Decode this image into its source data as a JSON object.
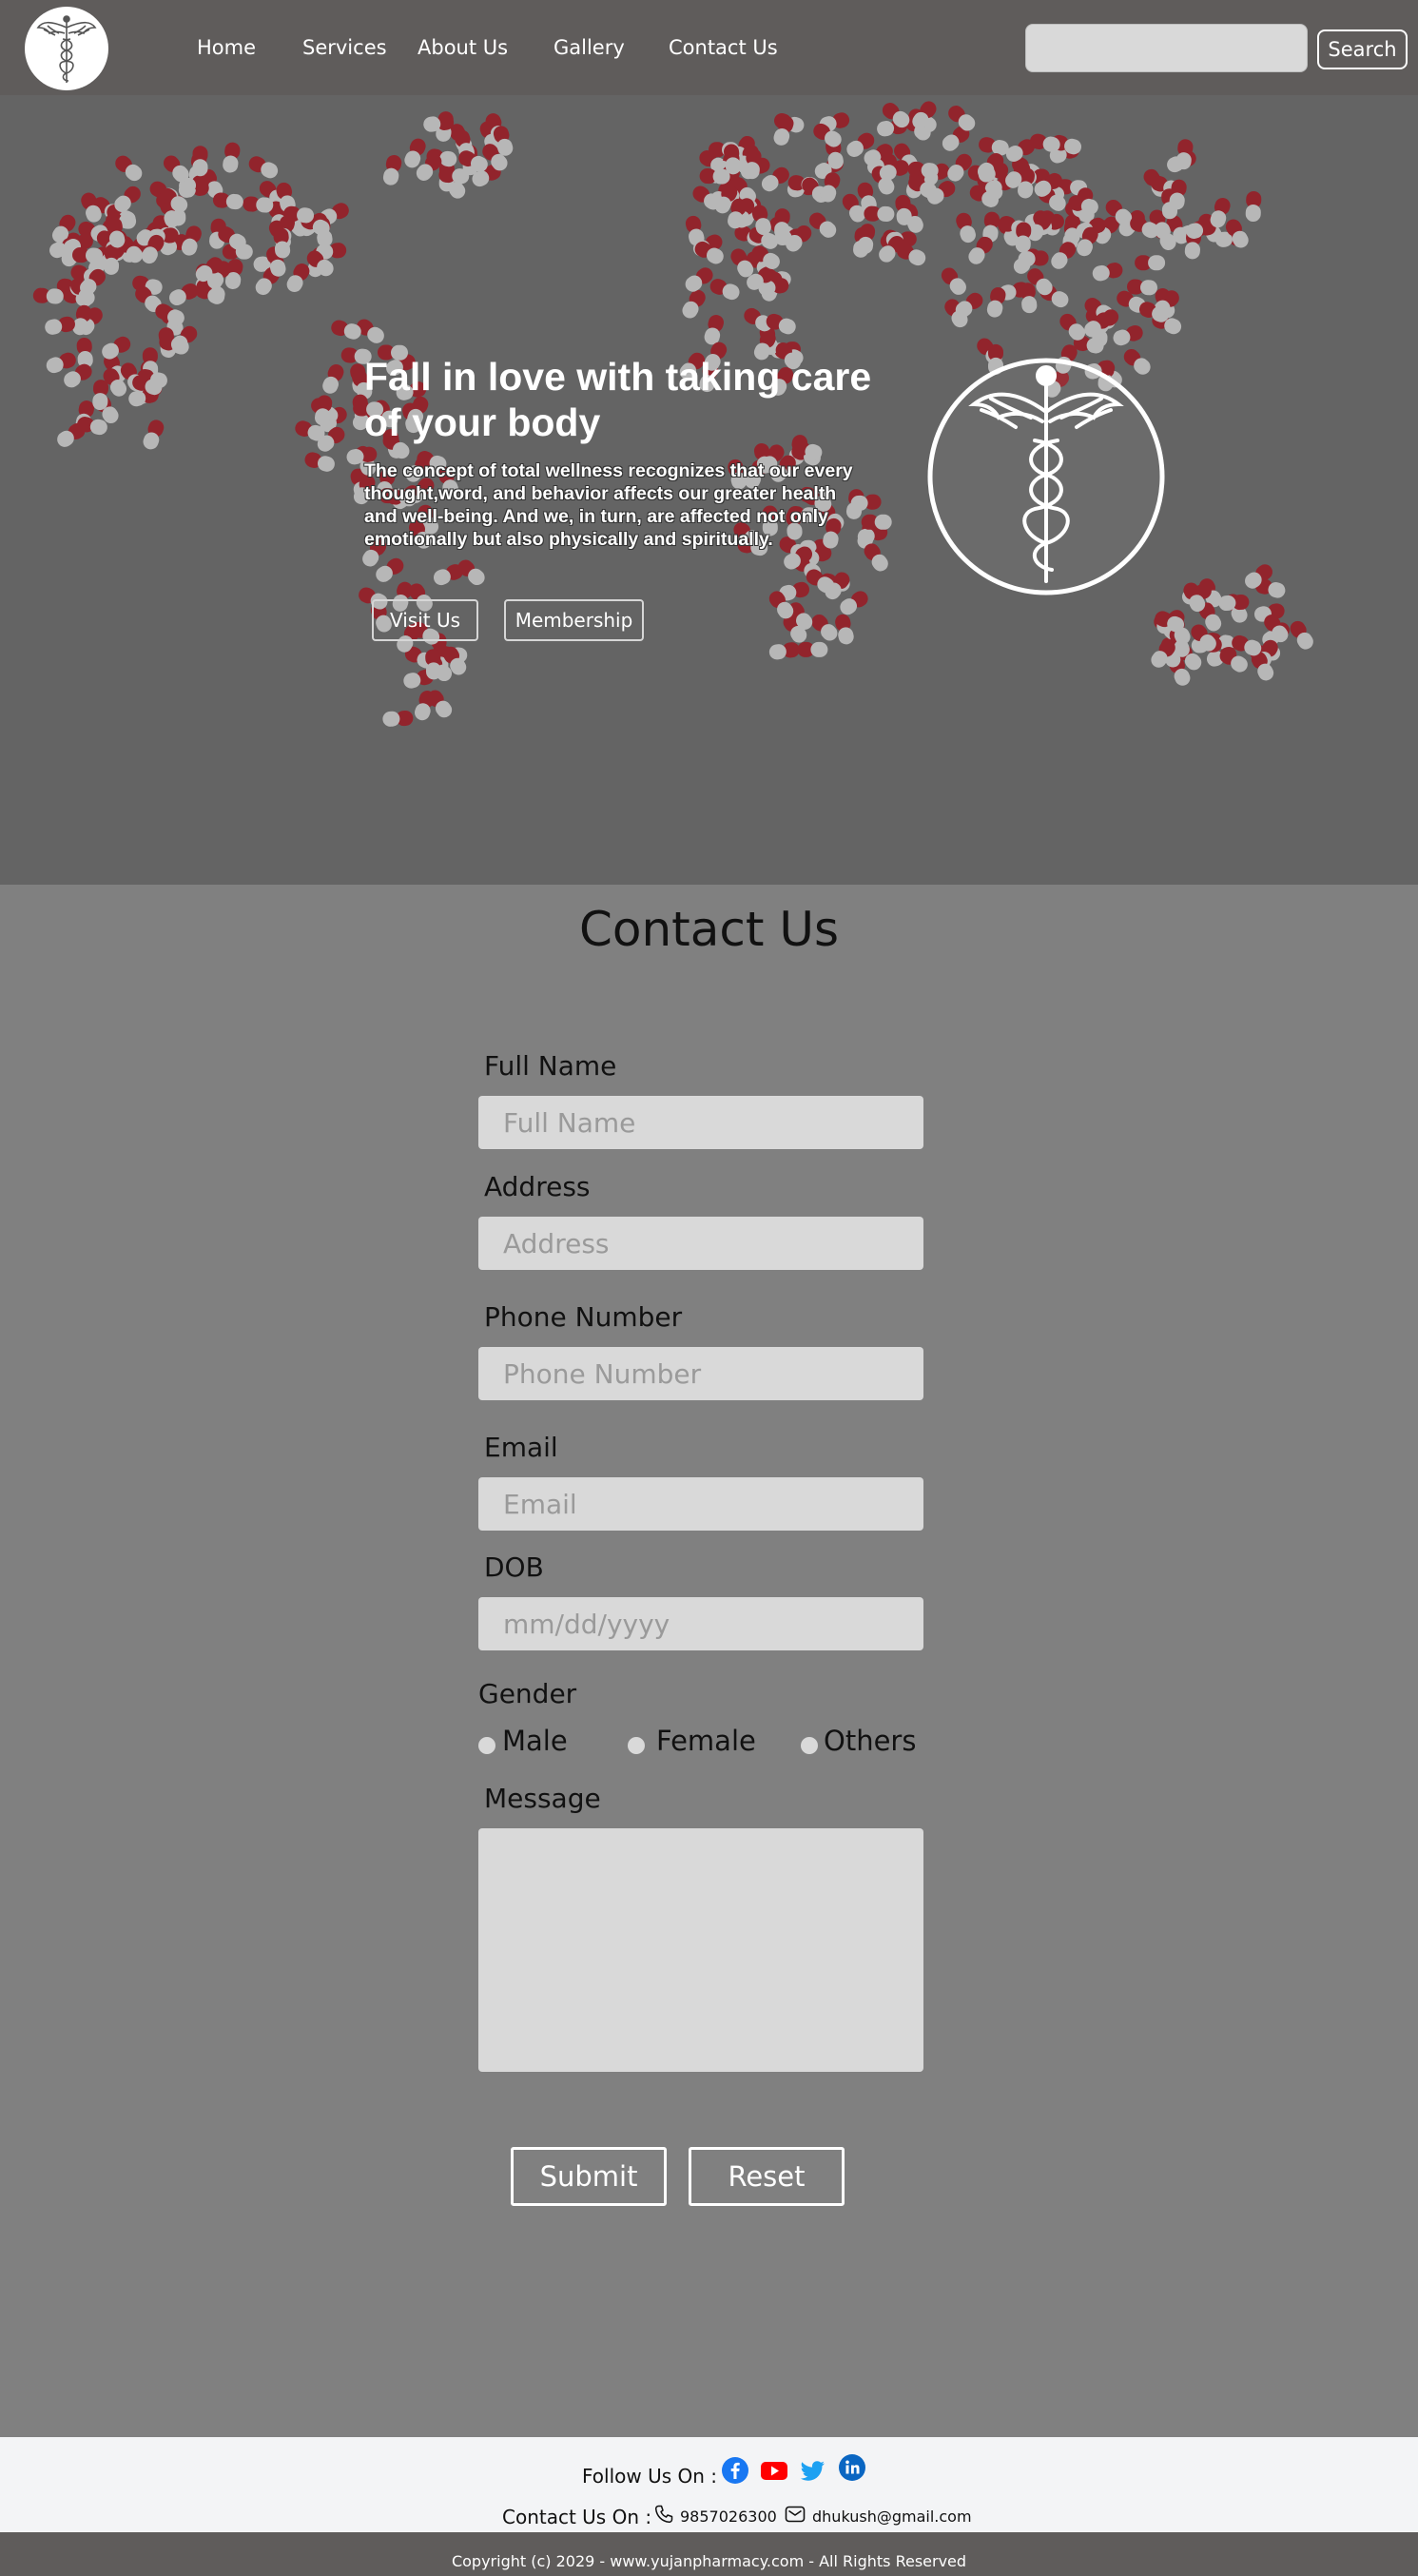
{
  "header": {
    "logo_icon": "caduceus-icon",
    "nav": [
      "Home",
      "Services",
      "About Us",
      "Gallery",
      "Contact Us"
    ],
    "search_placeholder": "",
    "search_label": "Search"
  },
  "hero": {
    "title": "Fall in love with taking care of your body",
    "text": "The concept of total wellness recognizes that our every thought,word, and behavior affects our greater health and well-being. And we, in turn, are affected not only emotionally but also physically and spiritually.",
    "visit_label": "Visit Us",
    "membership_label": "Membership",
    "emblem_icon": "caduceus-icon"
  },
  "contact": {
    "title": "Contact Us",
    "fields": {
      "full_name": {
        "label": "Full Name",
        "placeholder": "Full Name"
      },
      "address": {
        "label": "Address",
        "placeholder": "Address"
      },
      "phone": {
        "label": "Phone Number",
        "placeholder": "Phone Number"
      },
      "email": {
        "label": "Email",
        "placeholder": "Email"
      },
      "dob": {
        "label": "DOB",
        "placeholder": "mm/dd/yyyy"
      }
    },
    "gender": {
      "label": "Gender",
      "options": [
        "Male",
        "Female",
        "Others"
      ]
    },
    "message_label": "Message",
    "submit_label": "Submit",
    "reset_label": "Reset"
  },
  "footer": {
    "follow_label": "Follow Us On :",
    "social_icons": [
      "facebook-icon",
      "youtube-icon",
      "twitter-icon",
      "linkedin-icon"
    ],
    "contact_label": "Contact Us On :",
    "phone": "9857026300",
    "email": "dhukush@gmail.com",
    "copyright": "Copyright (c) 2029  -  www.yujanpharmacy.com - All Rights Reserved"
  },
  "colors": {
    "header_bg": "#5f5c5b",
    "page_bg": "#808080",
    "input_bg": "#d9d9d9",
    "pill_red": "#a5121d",
    "footer_bg": "#f3f4f6"
  }
}
